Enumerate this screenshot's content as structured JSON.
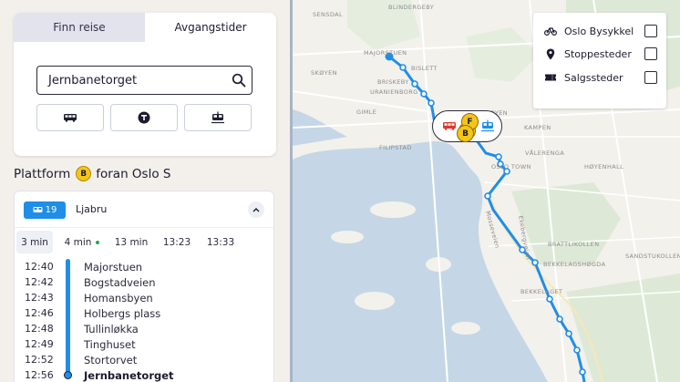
{
  "tabs": {
    "plan_trip": "Finn reise",
    "departures": "Avgangstider"
  },
  "search": {
    "value": "Jernbanetorget"
  },
  "modes": [
    {
      "icon": "bus-icon"
    },
    {
      "icon": "metro-icon"
    },
    {
      "icon": "tram-icon"
    }
  ],
  "platform": {
    "prefix": "Plattform",
    "code": "B",
    "location": "foran Oslo S"
  },
  "line": {
    "number": "19",
    "destination": "Ljabru",
    "mode_icon": "tram-icon",
    "color": "#1f8ee8"
  },
  "departures": [
    {
      "label": "3 min",
      "selected": true,
      "live": false
    },
    {
      "label": "4 min",
      "selected": false,
      "live": true
    },
    {
      "label": "13 min",
      "selected": false,
      "live": false
    },
    {
      "label": "13:23",
      "selected": false,
      "live": false
    },
    {
      "label": "13:33",
      "selected": false,
      "live": false
    }
  ],
  "stops": [
    {
      "time": "12:40",
      "name": "Majorstuen"
    },
    {
      "time": "12:42",
      "name": "Bogstadveien"
    },
    {
      "time": "12:43",
      "name": "Homansbyen"
    },
    {
      "time": "12:46",
      "name": "Holbergs plass"
    },
    {
      "time": "12:48",
      "name": "Tullinløkka"
    },
    {
      "time": "12:49",
      "name": "Tinghuset"
    },
    {
      "time": "12:52",
      "name": "Stortorvet"
    },
    {
      "time": "12:56",
      "name": "Jernbanetorget"
    }
  ],
  "legend": [
    {
      "label": "Oslo Bysykkel",
      "icon": "bicycle-icon",
      "checked": false
    },
    {
      "label": "Stoppesteder",
      "icon": "location-pin-icon",
      "checked": false
    },
    {
      "label": "Salgssteder",
      "icon": "ticket-icon",
      "checked": false
    }
  ],
  "map": {
    "labels": [
      "SENSDAL",
      "BLINDERGEBY",
      "MAJORSTUEN",
      "BISLETT",
      "SKØYEN",
      "BRISKEBY",
      "URANIENBORG",
      "GIMLE",
      "TØYEN",
      "KAMPEN",
      "FILIPSTAD",
      "VÅLERENGA",
      "OSLO TOWN",
      "HØYENHALL",
      "BRATTLIKOLLEN",
      "BEKKELAGSHØGDA",
      "BEKKELAGET",
      "SANDSTUKOLLEN",
      "Mosseveien",
      "Ekebergveien"
    ],
    "colors": {
      "land": "#f3f1ec",
      "water": "#c5d7e6",
      "park": "#dde9d6",
      "route": "#1f8ee8"
    },
    "cluster": {
      "codes": [
        "F",
        "B"
      ]
    }
  }
}
